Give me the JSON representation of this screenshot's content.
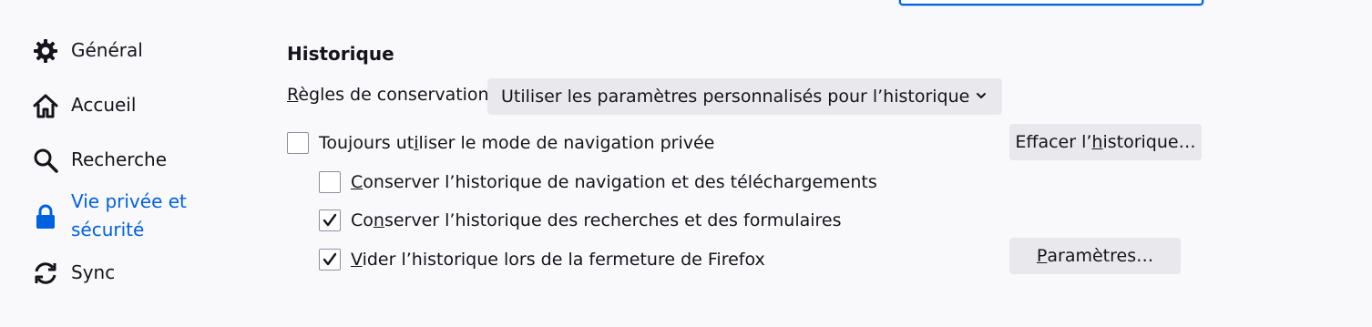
{
  "sidebar": {
    "items": [
      {
        "label": "Général",
        "icon": "gear-icon"
      },
      {
        "label": "Accueil",
        "icon": "home-icon"
      },
      {
        "label": "Recherche",
        "icon": "search-icon"
      },
      {
        "label": "Vie privée et sécurité",
        "icon": "lock-icon",
        "selected": true
      },
      {
        "label": "Sync",
        "icon": "sync-icon"
      }
    ]
  },
  "history": {
    "title": "Historique",
    "rules_label_first": "R",
    "rules_label_rest": "ègles de conservation",
    "rules_value": "Utiliser les paramètres personnalisés pour l’historique",
    "private_mode": {
      "pre": "Toujours ut",
      "accel": "i",
      "post": "liser le mode de navigation privée",
      "checked": false
    },
    "keep_browsing": {
      "pre": "",
      "accel": "C",
      "post": "onserver l’historique de navigation et des téléchargements",
      "checked": false
    },
    "keep_forms": {
      "pre": "Co",
      "accel": "n",
      "post": "server l’historique des recherches et des formulaires",
      "checked": true
    },
    "clear_on_close": {
      "pre": "",
      "accel": "V",
      "post": "ider l’historique lors de la fermeture de Firefox",
      "checked": true
    },
    "clear_button": {
      "pre": "Effacer l’",
      "accel": "h",
      "post": "istorique…"
    },
    "settings_button": {
      "pre": "",
      "accel": "P",
      "post": "aramètres…"
    }
  },
  "colors": {
    "accent": "#0061e0",
    "background": "#f9f9fb",
    "button": "#e9e9ed"
  }
}
